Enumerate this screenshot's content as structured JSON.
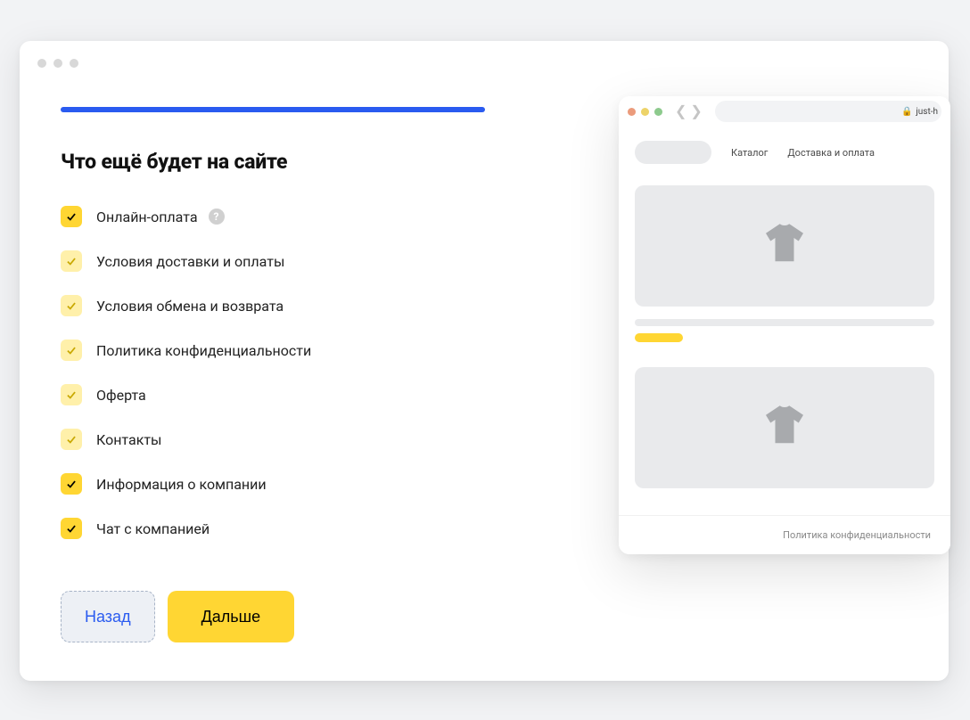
{
  "page": {
    "title": "Что ещё будет на сайте",
    "options": [
      {
        "label": "Онлайн-оплата",
        "variant": "strong",
        "help": true
      },
      {
        "label": "Условия доставки и оплаты",
        "variant": "soft",
        "help": false
      },
      {
        "label": "Условия обмена и возврата",
        "variant": "soft",
        "help": false
      },
      {
        "label": "Политика конфиденциальности",
        "variant": "soft",
        "help": false
      },
      {
        "label": "Оферта",
        "variant": "soft",
        "help": false
      },
      {
        "label": "Контакты",
        "variant": "soft",
        "help": false
      },
      {
        "label": "Информация о компании",
        "variant": "strong",
        "help": false
      },
      {
        "label": "Чат с компанией",
        "variant": "strong",
        "help": false
      }
    ],
    "buttons": {
      "back": "Назад",
      "next": "Дальше"
    }
  },
  "preview": {
    "url": "just-h",
    "nav": {
      "catalog": "Каталог",
      "delivery": "Доставка и оплата"
    },
    "footer": "Политика конфиденциальности"
  }
}
